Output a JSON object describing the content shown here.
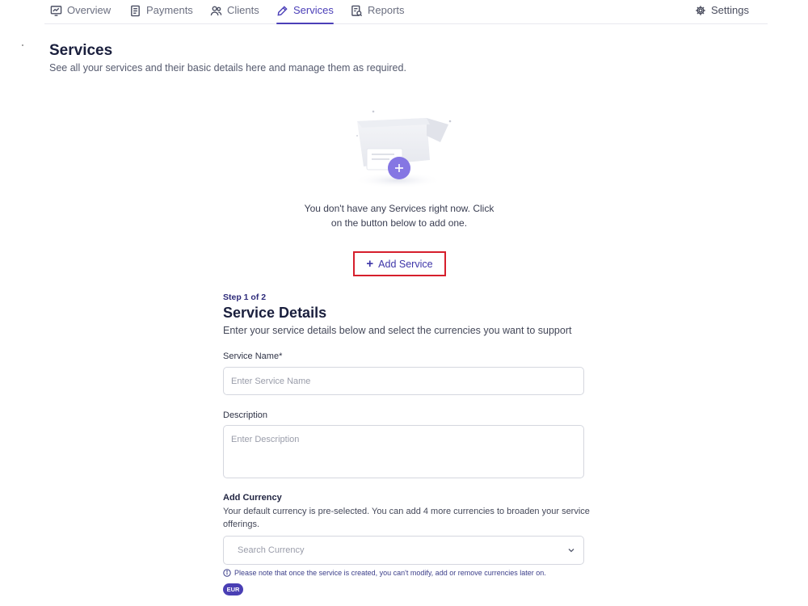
{
  "nav": {
    "tabs": [
      {
        "label": "Overview",
        "icon": "chart-screen-icon"
      },
      {
        "label": "Payments",
        "icon": "receipt-icon"
      },
      {
        "label": "Clients",
        "icon": "users-icon"
      },
      {
        "label": "Services",
        "icon": "pen-tool-icon",
        "active": true
      },
      {
        "label": "Reports",
        "icon": "report-icon"
      }
    ],
    "settings_label": "Settings"
  },
  "page": {
    "title": "Services",
    "subtitle": "See all your services and their basic details here and manage them as required."
  },
  "empty_state": {
    "message": "You don't have any Services right now. Click on the button below to add one.",
    "add_button_label": "Add Service",
    "add_button_icon": "plus-icon"
  },
  "form": {
    "step": "Step 1 of 2",
    "title": "Service Details",
    "subtitle": "Enter your service details below and select the currencies you want to support",
    "service_name": {
      "label": "Service Name*",
      "placeholder": "Enter Service Name",
      "value": ""
    },
    "description": {
      "label": "Description",
      "placeholder": "Enter Description",
      "value": ""
    },
    "currency": {
      "label": "Add Currency",
      "help": "Your default currency is pre-selected. You can add 4 more currencies to broaden your service offerings.",
      "search_placeholder": "Search Currency",
      "note": "Please note that once the service is created, you can't modify, add or remove currencies later on.",
      "selected": [
        "EUR"
      ]
    }
  },
  "colors": {
    "accent": "#4b3fb8",
    "highlight_border": "#d61f2c",
    "text_dark": "#1a1f3d",
    "chip_bg": "#4a3fb4"
  }
}
